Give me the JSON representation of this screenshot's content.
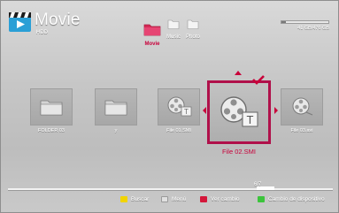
{
  "header": {
    "title": "Movie",
    "subtitle": "HDD"
  },
  "tabs": [
    {
      "label": "Movie",
      "active": true
    },
    {
      "label": "Music",
      "active": false
    },
    {
      "label": "Photo",
      "active": false
    }
  ],
  "storage": {
    "text": "41 GB/476 GB",
    "used_fraction": 0.09
  },
  "items": [
    {
      "label": "FOLDER 03",
      "kind": "folder"
    },
    {
      "label": "y",
      "kind": "folder"
    },
    {
      "label": "File 01.SMI",
      "kind": "subtitle-file"
    },
    {
      "label": "File 02.SMI",
      "kind": "subtitle-file",
      "selected": true
    },
    {
      "label": "File 03.avi",
      "kind": "video-file"
    }
  ],
  "page": {
    "indicator": "6/7"
  },
  "footer": {
    "buttons": [
      {
        "label": "Buscar",
        "color": "#f2d400"
      },
      {
        "label": "Menú",
        "color": "#e0e0e0"
      },
      {
        "label": "Ver cambio",
        "color": "#d4173a"
      },
      {
        "label": "Cambio de dispositivo",
        "color": "#3cc43c"
      }
    ]
  },
  "colors": {
    "accent": "#c8003a",
    "selection_border": "#b0104a"
  }
}
